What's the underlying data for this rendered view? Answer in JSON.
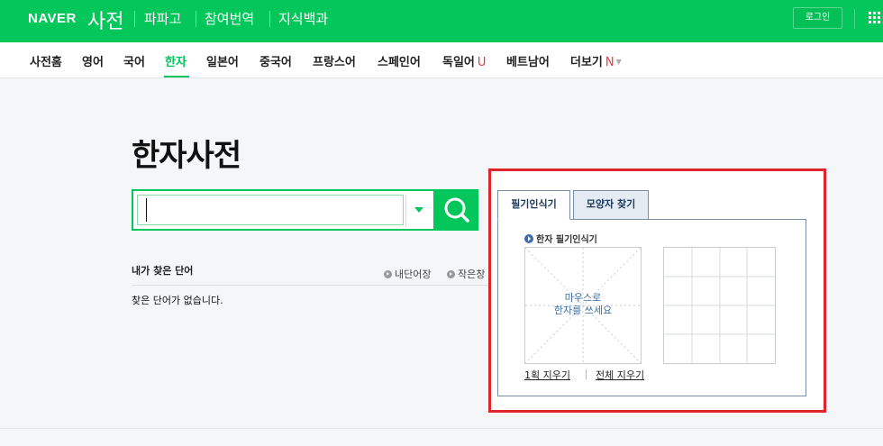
{
  "header": {
    "logo": "NAVER",
    "service": "사전",
    "links": [
      "파파고",
      "참여번역",
      "지식백과"
    ],
    "login_label": "로그인"
  },
  "nav": {
    "items": [
      {
        "label": "사전홈"
      },
      {
        "label": "영어"
      },
      {
        "label": "국어"
      },
      {
        "label": "한자",
        "active": true
      },
      {
        "label": "일본어"
      },
      {
        "label": "중국어"
      },
      {
        "label": "프랑스어"
      },
      {
        "label": "스페인어"
      },
      {
        "label": "독일어",
        "badge": "U"
      },
      {
        "label": "베트남어"
      },
      {
        "label": "더보기",
        "badge": "N"
      }
    ]
  },
  "page": {
    "title": "한자사전"
  },
  "search": {
    "value": "",
    "placeholder": ""
  },
  "recent": {
    "title": "내가 찾은 단어",
    "my_wordbook": "내단어장",
    "small_window": "작은창",
    "empty_message": "찾은 단어가 없습니다."
  },
  "handwriting": {
    "tab_handwriting": "필기인식기",
    "tab_shape": "모양자 찾기",
    "label": "한자 필기인식기",
    "hint_line1": "마우스로",
    "hint_line2": "한자를 쓰세요",
    "clear_one": "1획 지우기",
    "clear_all": "전체 지우기"
  },
  "colors": {
    "brand": "#03c75a",
    "highlight": "#e0242d",
    "panel_border": "#7a8ea8"
  }
}
